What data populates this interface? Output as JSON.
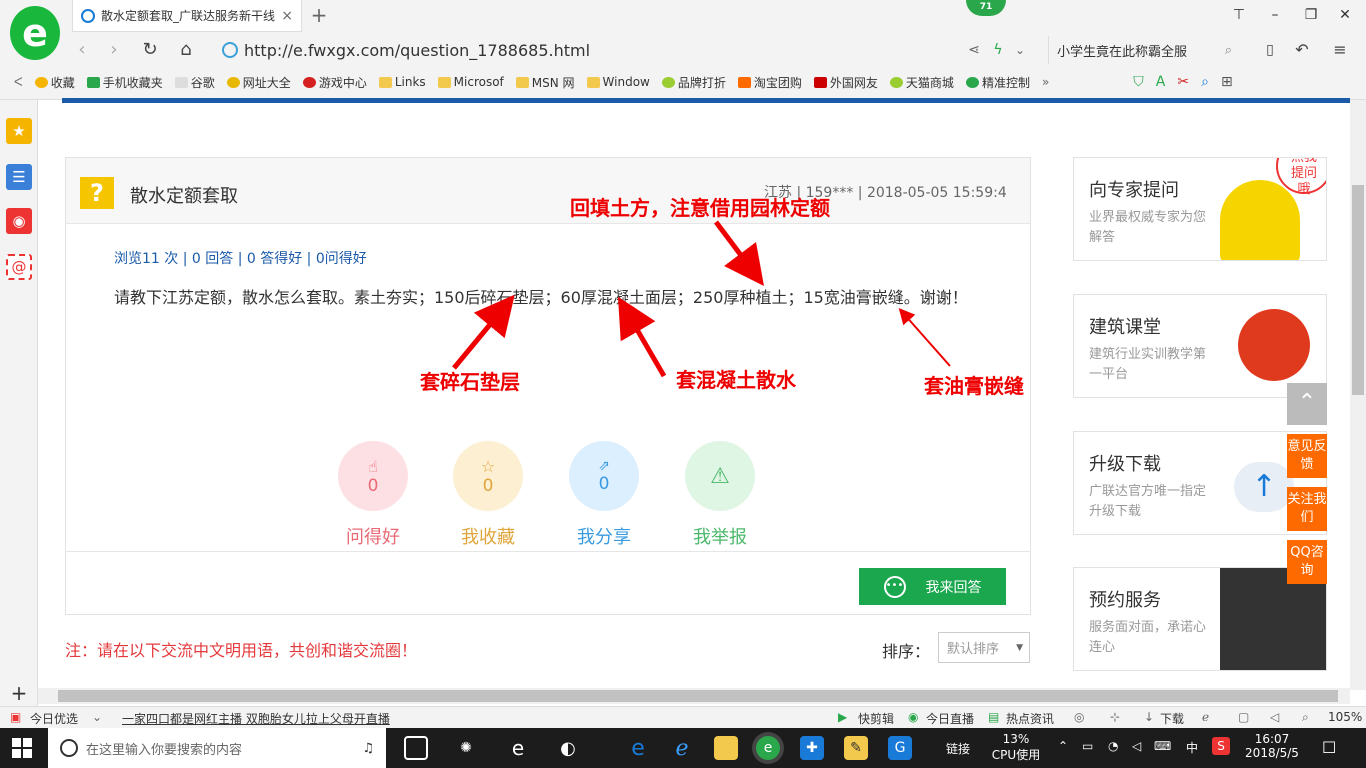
{
  "browser": {
    "tab_title": "散水定额套取_广联达服务新干线",
    "tab_close": "×",
    "new_tab": "+",
    "badge": "71",
    "url": "http://e.fwxgx.com/question_1788685.html",
    "search_text": "小学生竟在此称霸全服",
    "bookmarks": [
      "收藏",
      "手机收藏夹",
      "谷歌",
      "网址大全",
      "游戏中心",
      "Links",
      "Microsof",
      "MSN 网",
      "Window",
      "品牌打折",
      "淘宝团购",
      "外国网友",
      "天猫商城",
      "精准控制"
    ],
    "bookmark_more": "»"
  },
  "question": {
    "icon_glyph": "?",
    "title": "散水定额套取",
    "meta": "江苏 | 159*** | 2018-05-05 15:59:4",
    "stats": "浏览11 次 | 0 回答 | 0 答得好 | 0问得好",
    "body": "请教下江苏定额，散水怎么套取。素土夯实；150后碎石垫层；60厚混凝土面层；250厚种植土；15宽油膏嵌缝。谢谢！",
    "actions": [
      {
        "count": "0",
        "label": "问得好",
        "color": "#e86a76",
        "bg": "#fde0e3"
      },
      {
        "count": "0",
        "label": "我收藏",
        "color": "#e0a53a",
        "bg": "#fdf0d2"
      },
      {
        "count": "0",
        "label": "我分享",
        "color": "#3a9be0",
        "bg": "#dcefff"
      },
      {
        "count": "",
        "label": "我举报",
        "color": "#4cb86a",
        "bg": "#e0f6e5"
      }
    ],
    "answer_button": "我来回答"
  },
  "annotations": {
    "top": "回填土方，注意借用园林定额",
    "a1": "套碎石垫层",
    "a2": "套混凝土散水",
    "a3": "套油膏嵌缝"
  },
  "notice": "注：请在以下交流中文明用语，共创和谐交流圈！",
  "sort": {
    "label": "排序：",
    "value": "默认排序"
  },
  "right_cards": [
    {
      "title": "向专家提问",
      "sub": "业界最权威专家为您解答",
      "bubble": "点我提问哦"
    },
    {
      "title": "建筑课堂",
      "sub": "建筑行业实训教学第一平台"
    },
    {
      "title": "升级下载",
      "sub": "广联达官方唯一指定升级下载"
    },
    {
      "title": "预约服务",
      "sub": "服务面对面，承诺心连心"
    }
  ],
  "float_buttons": [
    "意见反馈",
    "关注我们",
    "QQ咨询"
  ],
  "statusbar": {
    "left": "今日优选",
    "headline": "一家四口都是网红主播 双胞胎女儿拉上父母开直播",
    "items": [
      "快剪辑",
      "今日直播",
      "热点资讯",
      "下载"
    ],
    "zoom": "105%"
  },
  "taskbar": {
    "search_placeholder": "在这里输入你要搜索的内容",
    "link": "链接",
    "cpu_pct": "13%",
    "cpu_label": "CPU使用",
    "ime": "中",
    "time": "16:07",
    "date": "2018/5/5"
  }
}
